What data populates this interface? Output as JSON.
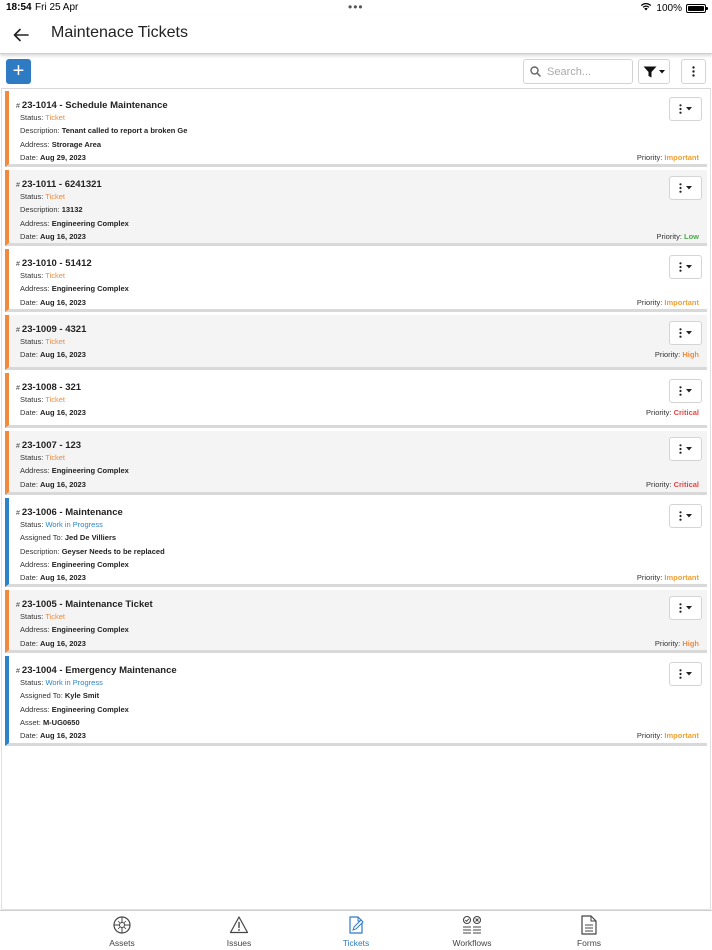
{
  "status_bar": {
    "time": "18:54",
    "date": "Fri 25 Apr",
    "battery": "100%",
    "battery_level": 1.0
  },
  "header": {
    "title": "Maintenace Tickets"
  },
  "toolbar": {
    "add_label": "+",
    "search_placeholder": "Search..."
  },
  "labels": {
    "status": "Status: ",
    "description": "Description: ",
    "address": "Address: ",
    "date": "Date: ",
    "assigned_to": "Assigned To: ",
    "asset": "Asset: ",
    "priority": "Priority: ",
    "hash": "#"
  },
  "colors": {
    "accent": "#2e7bc4",
    "ticket_stripe": "#f08a3e",
    "wip_stripe": "#2b84c8",
    "important": "#f0a030",
    "low": "#4aa84a",
    "high": "#f08a3e",
    "critical": "#e04848"
  },
  "tickets": [
    {
      "id": "23-1014",
      "name": "Schedule Maintenance",
      "status": "Ticket",
      "description": "Tenant called to report a broken Ge",
      "address": "Strorage Area",
      "date": "Aug 29, 2023",
      "priority": "Important"
    },
    {
      "id": "23-1011",
      "name": "6241321",
      "status": "Ticket",
      "description": "13132",
      "address": "Engineering Complex",
      "date": "Aug 16, 2023",
      "priority": "Low"
    },
    {
      "id": "23-1010",
      "name": "51412",
      "status": "Ticket",
      "address": "Engineering Complex",
      "date": "Aug 16, 2023",
      "priority": "Important"
    },
    {
      "id": "23-1009",
      "name": "4321",
      "status": "Ticket",
      "date": "Aug 16, 2023",
      "priority": "High"
    },
    {
      "id": "23-1008",
      "name": "321",
      "status": "Ticket",
      "date": "Aug 16, 2023",
      "priority": "Critical"
    },
    {
      "id": "23-1007",
      "name": "123",
      "status": "Ticket",
      "address": "Engineering Complex",
      "date": "Aug 16, 2023",
      "priority": "Critical"
    },
    {
      "id": "23-1006",
      "name": "Maintenance",
      "status": "Work in Progress",
      "assigned_to": "Jed De Villiers",
      "description": "Geyser Needs to be replaced",
      "address": "Engineering Complex",
      "date": "Aug 16, 2023",
      "priority": "Important"
    },
    {
      "id": "23-1005",
      "name": "Maintenance Ticket",
      "status": "Ticket",
      "address": "Engineering Complex",
      "date": "Aug 16, 2023",
      "priority": "High"
    },
    {
      "id": "23-1004",
      "name": "Emergency Maintenance",
      "status": "Work in Progress",
      "assigned_to": "Kyle Smit",
      "address": "Engineering Complex",
      "asset": "M-UG0650",
      "date": "Aug 16, 2023",
      "priority": "Important"
    }
  ],
  "tabs": [
    {
      "label": "Assets",
      "icon": "assets-icon",
      "active": false
    },
    {
      "label": "Issues",
      "icon": "warning-icon",
      "active": false
    },
    {
      "label": "Tickets",
      "icon": "ticket-edit-icon",
      "active": true
    },
    {
      "label": "Workflows",
      "icon": "workflow-icon",
      "active": false
    },
    {
      "label": "Forms",
      "icon": "form-document-icon",
      "active": false
    }
  ]
}
